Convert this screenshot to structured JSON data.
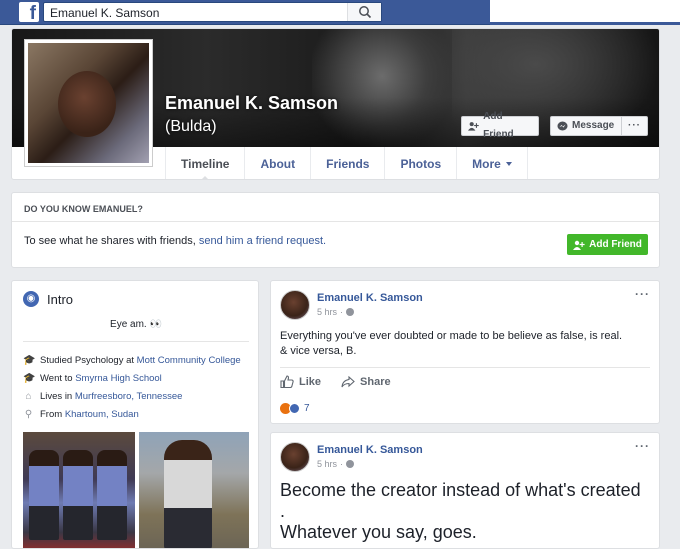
{
  "topbar": {
    "logo": "f",
    "search_value": "Emanuel K. Samson"
  },
  "profile": {
    "name": "Emanuel K. Samson",
    "alternate_name": "(Bulda)",
    "add_friend_label": "Add Friend",
    "message_label": "Message",
    "more_label": "···"
  },
  "tabs": [
    {
      "label": "Timeline"
    },
    {
      "label": "About"
    },
    {
      "label": "Friends"
    },
    {
      "label": "Photos"
    },
    {
      "label": "More"
    }
  ],
  "know": {
    "heading": "DO YOU KNOW EMANUEL?",
    "text_prefix": "To see what he shares with friends, ",
    "link": "send him a friend request.",
    "button": "Add Friend"
  },
  "intro": {
    "title": "Intro",
    "bio": "Eye am. 👀",
    "items": [
      {
        "prefix": "Studied Psychology at ",
        "link": "Mott Community College"
      },
      {
        "prefix": "Went to ",
        "link": "Smyrna High School"
      },
      {
        "prefix": "Lives in ",
        "link": "Murfreesboro, Tennessee"
      },
      {
        "prefix": "From ",
        "link": "Khartoum, Sudan"
      }
    ]
  },
  "posts": [
    {
      "author": "Emanuel K. Samson",
      "time": "5 hrs",
      "text": "Everything you've ever doubted or made to be believe as false, is real.\n& vice versa, B.",
      "like_label": "Like",
      "share_label": "Share",
      "reaction_count": "7"
    },
    {
      "author": "Emanuel K. Samson",
      "time": "5 hrs",
      "text": "Become the creator instead of what's created\n.\nWhatever you say, goes."
    }
  ],
  "colors": {
    "brand": "#3b5998",
    "link": "#365899",
    "green": "#42b72a"
  }
}
